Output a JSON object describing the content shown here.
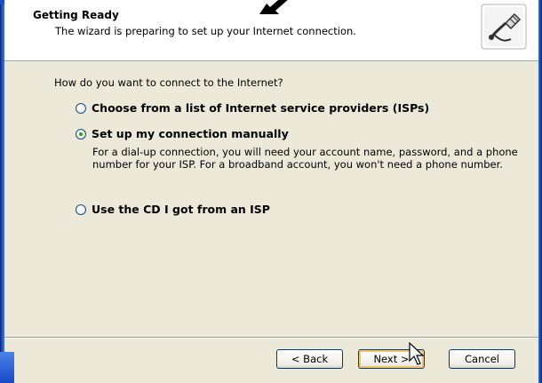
{
  "header": {
    "title": "Getting Ready",
    "subtitle": "The wizard is preparing to set up your Internet connection.",
    "icon": "network-cable-icon"
  },
  "body": {
    "question": "How do you want to connect to the Internet?",
    "options": [
      {
        "label": "Choose from a list of Internet service providers (ISPs)",
        "checked": false
      },
      {
        "label": "Set up my connection manually",
        "checked": true,
        "description": "For a dial-up connection, you will need your account name, password, and a phone number for your ISP. For a broadband account, you won't need a phone number."
      },
      {
        "label": "Use the CD I got from an ISP",
        "checked": false
      }
    ]
  },
  "footer": {
    "back_label": "< Back",
    "next_label": "Next >",
    "cancel_label": "Cancel"
  },
  "colors": {
    "frame_blue": "#1b4fd0",
    "dialog_bg": "#ece9d8",
    "radio_check": "#21a121"
  }
}
